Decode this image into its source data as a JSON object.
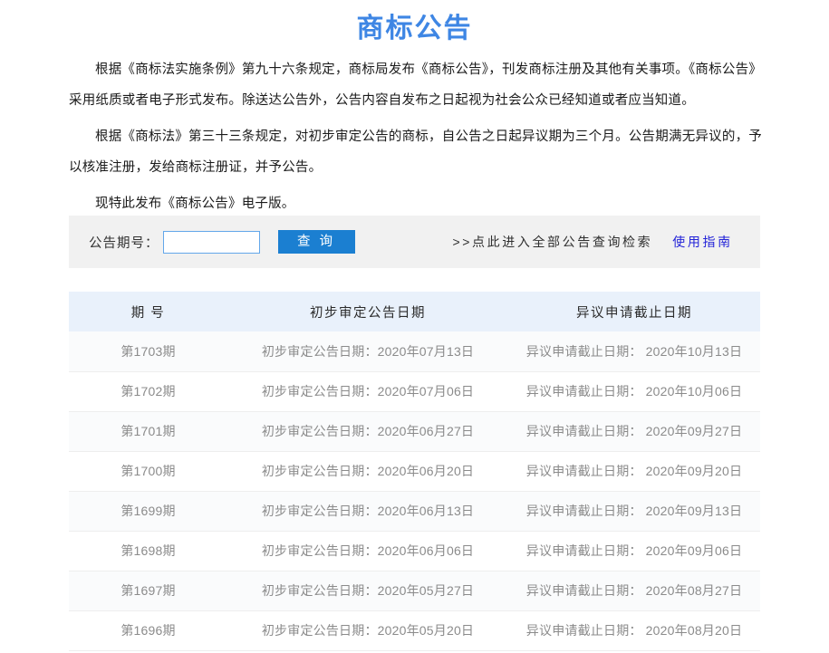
{
  "header": {
    "title": "商标公告"
  },
  "intro": {
    "paragraphs": [
      "根据《商标法实施条例》第九十六条规定，商标局发布《商标公告》，刊发商标注册及其他有关事项。《商标公告》采用纸质或者电子形式发布。除送达公告外，公告内容自发布之日起视为社会公众已经知道或者应当知道。",
      "根据《商标法》第三十三条规定，对初步审定公告的商标，自公告之日起异议期为三个月。公告期满无异议的，予以核准注册，发给商标注册证，并予公告。",
      "现特此发布《商标公告》电子版。"
    ]
  },
  "search": {
    "label": "公告期号：",
    "input_value": "",
    "input_placeholder": "",
    "button_label": "查 询",
    "all_search_link": ">>点此进入全部公告查询检索",
    "guide_link": "使用指南"
  },
  "table": {
    "columns": [
      "期 号",
      "初步审定公告日期",
      "异议申请截止日期"
    ],
    "rows": [
      {
        "issue": "第1703期",
        "publish_date": "初步审定公告日期：2020年07月13日",
        "opposition_deadline": "异议申请截止日期： 2020年10月13日"
      },
      {
        "issue": "第1702期",
        "publish_date": "初步审定公告日期：2020年07月06日",
        "opposition_deadline": "异议申请截止日期： 2020年10月06日"
      },
      {
        "issue": "第1701期",
        "publish_date": "初步审定公告日期：2020年06月27日",
        "opposition_deadline": "异议申请截止日期： 2020年09月27日"
      },
      {
        "issue": "第1700期",
        "publish_date": "初步审定公告日期：2020年06月20日",
        "opposition_deadline": "异议申请截止日期： 2020年09月20日"
      },
      {
        "issue": "第1699期",
        "publish_date": "初步审定公告日期：2020年06月13日",
        "opposition_deadline": "异议申请截止日期： 2020年09月13日"
      },
      {
        "issue": "第1698期",
        "publish_date": "初步审定公告日期：2020年06月06日",
        "opposition_deadline": "异议申请截止日期： 2020年09月06日"
      },
      {
        "issue": "第1697期",
        "publish_date": "初步审定公告日期：2020年05月27日",
        "opposition_deadline": "异议申请截止日期： 2020年08月27日"
      },
      {
        "issue": "第1696期",
        "publish_date": "初步审定公告日期：2020年05月20日",
        "opposition_deadline": "异议申请截止日期： 2020年08月20日"
      }
    ]
  },
  "colors": {
    "title_blue": "#3e86e4",
    "button_blue": "#1b7fd1",
    "link_blue": "#2424d8",
    "table_header_bg": "#e9f1fb",
    "panel_bg": "#f1f1f1",
    "input_border": "#63a7ea"
  }
}
